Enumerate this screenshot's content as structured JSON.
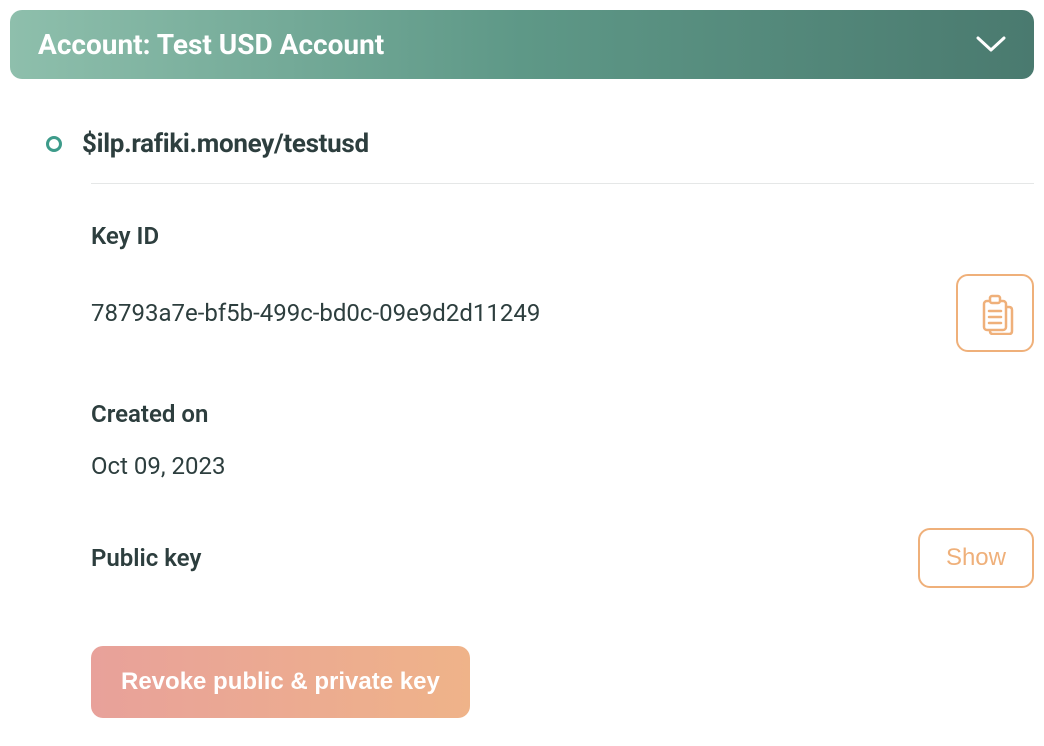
{
  "header": {
    "title": "Account: Test USD Account"
  },
  "wallet": {
    "address": "$ilp.rafiki.money/testusd"
  },
  "keyId": {
    "label": "Key ID",
    "value": "78793a7e-bf5b-499c-bd0c-09e9d2d11249"
  },
  "createdOn": {
    "label": "Created on",
    "value": "Oct 09, 2023"
  },
  "publicKey": {
    "label": "Public key",
    "showLabel": "Show"
  },
  "revoke": {
    "label": "Revoke public & private key"
  }
}
